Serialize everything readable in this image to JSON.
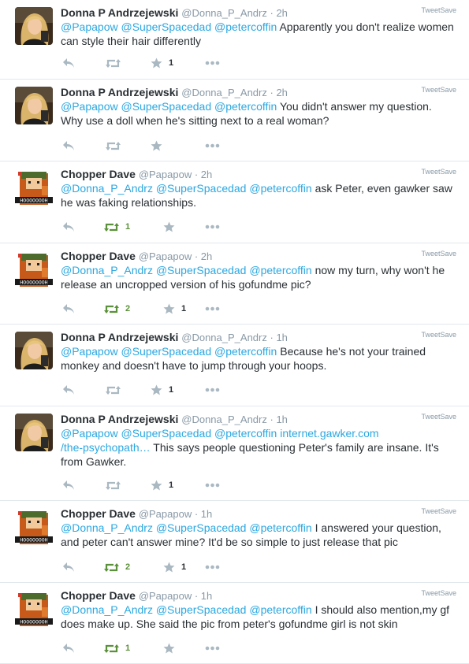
{
  "app": {
    "tweetsave_label": "TweetSave"
  },
  "colors": {
    "link": "#2ba7e0",
    "retweet_active": "#5c913b",
    "icon_gray": "#aab8c2",
    "separator": "#e1e8ed"
  },
  "tweets": [
    {
      "author": "Donna P Andrzejewski",
      "handle": "@Donna_P_Andrz",
      "time": "2h",
      "avatar": "donna-avatar",
      "body": [
        {
          "t": "@Papapow",
          "k": "mention"
        },
        {
          "t": " "
        },
        {
          "t": "@SuperSpacedad",
          "k": "mention"
        },
        {
          "t": " "
        },
        {
          "t": "@petercoffin",
          "k": "mention"
        },
        {
          "t": " Apparently you don't realize women can style their hair differently"
        }
      ],
      "retweets": "",
      "favorites": "1",
      "retweeted": false
    },
    {
      "author": "Donna P Andrzejewski",
      "handle": "@Donna_P_Andrz",
      "time": "2h",
      "avatar": "donna-avatar",
      "body": [
        {
          "t": "@Papapow",
          "k": "mention"
        },
        {
          "t": " "
        },
        {
          "t": "@SuperSpacedad",
          "k": "mention"
        },
        {
          "t": " "
        },
        {
          "t": "@petercoffin",
          "k": "mention"
        },
        {
          "t": " You didn't answer my question. Why use a doll when he's sitting next to a real woman?"
        }
      ],
      "retweets": "",
      "favorites": "",
      "retweeted": false
    },
    {
      "author": "Chopper Dave",
      "handle": "@Papapow",
      "time": "2h",
      "avatar": "dave-avatar",
      "body": [
        {
          "t": "@Donna_P_Andrz",
          "k": "mention"
        },
        {
          "t": " "
        },
        {
          "t": "@SuperSpacedad",
          "k": "mention"
        },
        {
          "t": " "
        },
        {
          "t": "@petercoffin",
          "k": "mention"
        },
        {
          "t": " ask Peter, even gawker saw he was faking relationships."
        }
      ],
      "retweets": "1",
      "favorites": "",
      "retweeted": true
    },
    {
      "author": "Chopper Dave",
      "handle": "@Papapow",
      "time": "2h",
      "avatar": "dave-avatar",
      "body": [
        {
          "t": "@Donna_P_Andrz",
          "k": "mention"
        },
        {
          "t": " "
        },
        {
          "t": "@SuperSpacedad",
          "k": "mention"
        },
        {
          "t": " "
        },
        {
          "t": "@petercoffin",
          "k": "mention"
        },
        {
          "t": " now my turn, why won't he release an uncropped version of his gofundme pic?"
        }
      ],
      "retweets": "2",
      "favorites": "1",
      "retweeted": true
    },
    {
      "author": "Donna P Andrzejewski",
      "handle": "@Donna_P_Andrz",
      "time": "1h",
      "avatar": "donna-avatar",
      "body": [
        {
          "t": "@Papapow",
          "k": "mention"
        },
        {
          "t": " "
        },
        {
          "t": "@SuperSpacedad",
          "k": "mention"
        },
        {
          "t": " "
        },
        {
          "t": "@petercoffin",
          "k": "mention"
        },
        {
          "t": " Because he's not your trained monkey and doesn't have to jump through your hoops."
        }
      ],
      "retweets": "",
      "favorites": "1",
      "retweeted": false
    },
    {
      "author": "Donna P Andrzejewski",
      "handle": "@Donna_P_Andrz",
      "time": "1h",
      "avatar": "donna-avatar",
      "body": [
        {
          "t": "@Papapow",
          "k": "mention"
        },
        {
          "t": " "
        },
        {
          "t": "@SuperSpacedad",
          "k": "mention"
        },
        {
          "t": " "
        },
        {
          "t": "@petercoffin",
          "k": "mention"
        },
        {
          "t": " "
        },
        {
          "t": "internet.gawker.com",
          "k": "link"
        },
        {
          "br": true
        },
        {
          "t": "/the-psychopath…",
          "k": "link"
        },
        {
          "t": " This says people questioning Peter's family are insane. It's from Gawker."
        }
      ],
      "retweets": "",
      "favorites": "1",
      "retweeted": false
    },
    {
      "author": "Chopper Dave",
      "handle": "@Papapow",
      "time": "1h",
      "avatar": "dave-avatar",
      "body": [
        {
          "t": "@Donna_P_Andrz",
          "k": "mention"
        },
        {
          "t": " "
        },
        {
          "t": "@SuperSpacedad",
          "k": "mention"
        },
        {
          "t": " "
        },
        {
          "t": "@petercoffin",
          "k": "mention"
        },
        {
          "t": " I answered your question, and peter can't answer mine? It'd be so simple to just release that pic"
        }
      ],
      "retweets": "2",
      "favorites": "1",
      "retweeted": true
    },
    {
      "author": "Chopper Dave",
      "handle": "@Papapow",
      "time": "1h",
      "avatar": "dave-avatar",
      "body": [
        {
          "t": "@Donna_P_Andrz",
          "k": "mention"
        },
        {
          "t": " "
        },
        {
          "t": "@SuperSpacedad",
          "k": "mention"
        },
        {
          "t": " "
        },
        {
          "t": "@petercoffin",
          "k": "mention"
        },
        {
          "t": " I should also mention,my gf does make up. She said the pic from peter's gofundme girl is not skin"
        }
      ],
      "retweets": "1",
      "favorites": "",
      "retweeted": true
    }
  ]
}
